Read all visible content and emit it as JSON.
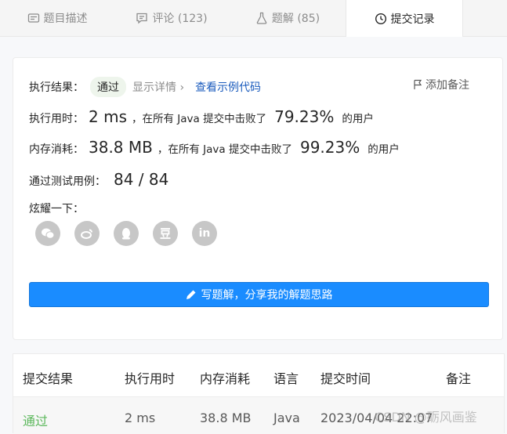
{
  "tabs": [
    {
      "label": "题目描述",
      "icon": "description-icon"
    },
    {
      "label": "评论 (123)",
      "icon": "comment-icon"
    },
    {
      "label": "题解 (85)",
      "icon": "flask-icon"
    },
    {
      "label": "提交记录",
      "icon": "clock-icon"
    }
  ],
  "result": {
    "status_label": "执行结果：",
    "status": "通过",
    "details_link": "显示详情",
    "sample_code_link": "查看示例代码",
    "add_note": "添加备注",
    "runtime_label": "执行用时：",
    "runtime": "2 ms",
    "runtime_prefix": "，在所有 Java 提交中击败了",
    "runtime_pct": "79.23%",
    "runtime_suffix": "的用户",
    "memory_label": "内存消耗：",
    "memory": "38.8 MB",
    "memory_prefix": "，在所有 Java 提交中击败了",
    "memory_pct": "99.23%",
    "memory_suffix": "的用户",
    "tests_label": "通过测试用例：",
    "tests": "84 / 84",
    "share_label": "炫耀一下：",
    "share_icons": [
      "wechat-icon",
      "weibo-icon",
      "qq-icon",
      "douban-icon",
      "linkedin-icon"
    ],
    "write_solution": "写题解，分享我的解题思路"
  },
  "table": {
    "headers": [
      "提交结果",
      "执行用时",
      "内存消耗",
      "语言",
      "提交时间",
      "备注"
    ],
    "rows": [
      {
        "result": "通过",
        "runtime": "2 ms",
        "memory": "38.8 MB",
        "language": "Java",
        "time": "2023/04/04 22:07"
      }
    ]
  },
  "watermark": "CSDN @砺风画鉴",
  "colors": {
    "accent": "#1a8cff",
    "pass": "#5cb85c",
    "link": "#1a5bbd"
  }
}
